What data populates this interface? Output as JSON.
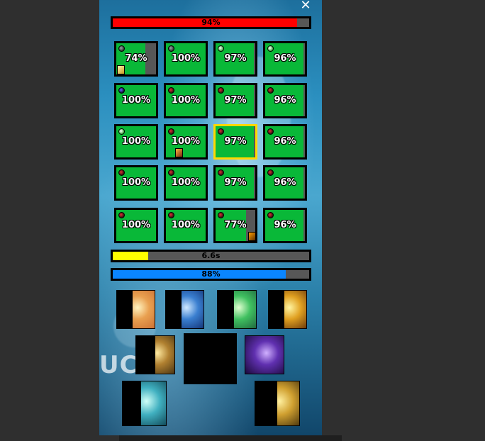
{
  "window": {
    "close_symbol": "✕"
  },
  "health_bar": {
    "label": "94%",
    "value": 0.94,
    "color": "#ff0000"
  },
  "cast_bar": {
    "label": "6.6s",
    "value": 0.18,
    "color": "#ffff00"
  },
  "mana_bar": {
    "label": "88%",
    "value": 0.88,
    "color": "#0a86ff"
  },
  "grid": {
    "rows": [
      [
        {
          "pct": "74%",
          "value": 0.74,
          "role": "role-a-icon",
          "debuff": "gold-debuff-icon"
        },
        {
          "pct": "100%",
          "value": 1.0,
          "role": "role-a-icon"
        },
        {
          "pct": "97%",
          "value": 0.97,
          "role": "role-c-icon"
        },
        {
          "pct": "96%",
          "value": 0.96,
          "role": "role-c-icon"
        }
      ],
      [
        {
          "pct": "100%",
          "value": 1.0,
          "role": "role-d-icon"
        },
        {
          "pct": "100%",
          "value": 1.0,
          "role": "role-b-icon"
        },
        {
          "pct": "97%",
          "value": 0.97,
          "role": "role-b-icon"
        },
        {
          "pct": "96%",
          "value": 0.96,
          "role": "role-b-icon"
        }
      ],
      [
        {
          "pct": "100%",
          "value": 1.0,
          "role": "role-c-icon"
        },
        {
          "pct": "100%",
          "value": 1.0,
          "role": "role-b-icon",
          "debuff": "fire-debuff-icon"
        },
        {
          "pct": "97%",
          "value": 0.97,
          "role": "role-b-icon",
          "selected": true
        },
        {
          "pct": "96%",
          "value": 0.96,
          "role": "role-b-icon"
        }
      ],
      [
        {
          "pct": "100%",
          "value": 1.0,
          "role": "role-b-icon"
        },
        {
          "pct": "100%",
          "value": 1.0,
          "role": "role-b-icon"
        },
        {
          "pct": "97%",
          "value": 0.97,
          "role": "role-b-icon"
        },
        {
          "pct": "96%",
          "value": 0.96,
          "role": "role-b-icon"
        }
      ],
      [
        {
          "pct": "100%",
          "value": 1.0,
          "role": "role-b-icon"
        },
        {
          "pct": "100%",
          "value": 1.0,
          "role": "role-b-icon"
        },
        {
          "pct": "77%",
          "value": 0.77,
          "role": "role-b-icon",
          "debuff": "orange-debuff-icon"
        },
        {
          "pct": "96%",
          "value": 0.96,
          "role": "role-b-icon"
        }
      ]
    ]
  },
  "spells": [
    {
      "name": "holy-light-spell-icon",
      "colors": [
        "#fff3c0",
        "#e9a050",
        "#c86a30"
      ],
      "cooldown": 0.42
    },
    {
      "name": "blue-hand-spell-icon",
      "colors": [
        "#cfe8ff",
        "#3a7fd0",
        "#0e2a6a"
      ],
      "cooldown": 0.42
    },
    {
      "name": "green-hand-spell-icon",
      "colors": [
        "#e0ffd0",
        "#40c060",
        "#1a5a3a"
      ],
      "cooldown": 0.42
    },
    {
      "name": "golden-burst-spell-icon",
      "colors": [
        "#fff4a0",
        "#e0a020",
        "#5a2a08"
      ],
      "cooldown": 0.42
    },
    {
      "name": "golden-shield-spell-icon",
      "colors": [
        "#ffeaa0",
        "#b08030",
        "#3a2a10"
      ],
      "cooldown": 0.5
    },
    {
      "name": "empty-spell-slot-icon",
      "colors": [
        "#000000",
        "#000000",
        "#000000"
      ],
      "cooldown": 1.0
    },
    {
      "name": "purple-vortex-spell-icon",
      "colors": [
        "#d0b0ff",
        "#6030b0",
        "#1a0a3a"
      ],
      "cooldown": 0.0
    },
    {
      "name": "cyan-hand-spell-icon",
      "colors": [
        "#d0fff8",
        "#40b0c0",
        "#0a3a4a"
      ],
      "cooldown": 0.42
    },
    {
      "name": "gold-column-spell-icon",
      "colors": [
        "#fff0a0",
        "#d0a030",
        "#3a2808"
      ],
      "cooldown": 0.5
    }
  ]
}
